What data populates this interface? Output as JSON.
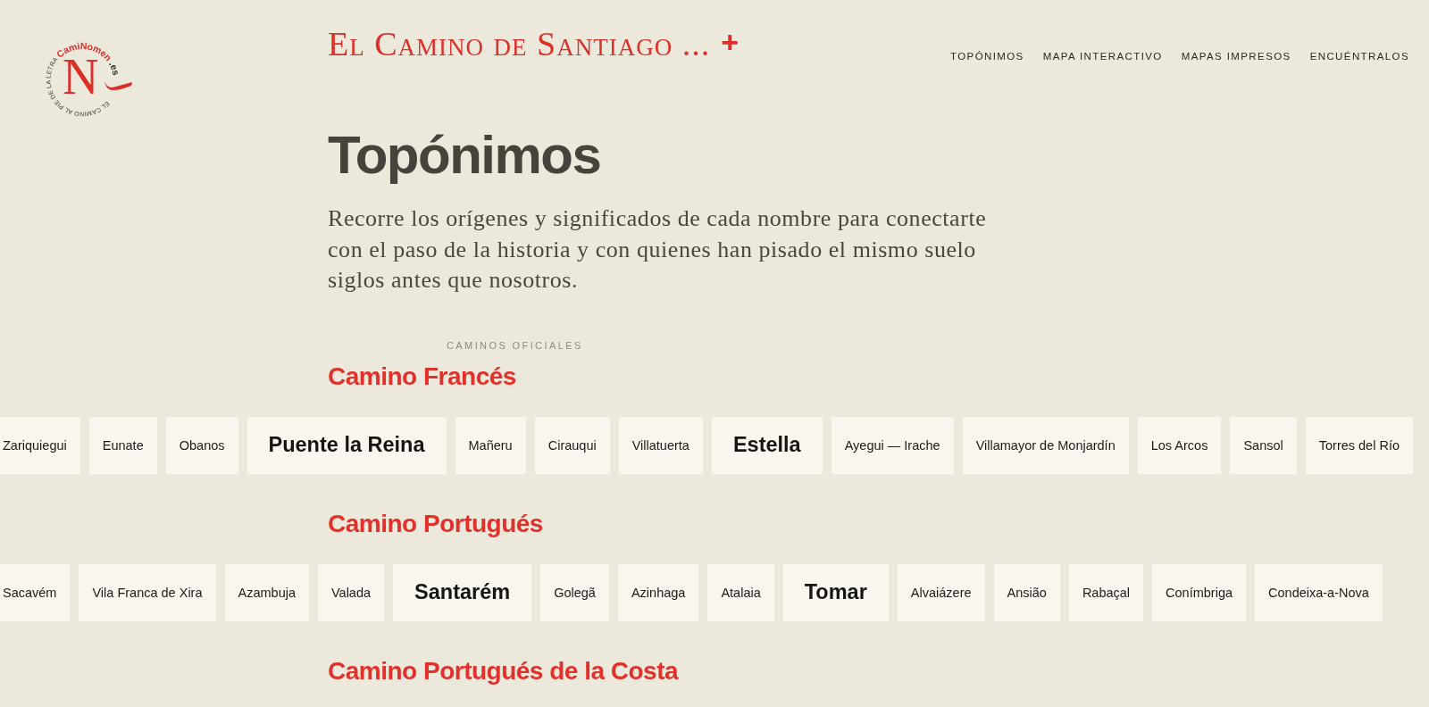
{
  "logo": {
    "wordmark": "CamiNomen",
    "domain": ".es",
    "letter": "N",
    "tagline": "EL CAMINO AL PIE DE LA LETRA"
  },
  "header": {
    "title": "El Camino de Santiago ...",
    "action": "+"
  },
  "nav": [
    {
      "label": "TOPÓNIMOS"
    },
    {
      "label": "MAPA INTERACTIVO"
    },
    {
      "label": "MAPAS IMPRESOS"
    },
    {
      "label": "ENCUÉNTRALOS"
    }
  ],
  "page": {
    "title": "Topónimos",
    "intro": "Recorre los orígenes y significados de cada nombre para conectarte con el paso de la historia y con quienes han pisado el mismo suelo siglos antes que nosotros."
  },
  "section_label": "CAMINOS OFICIALES",
  "routes": [
    {
      "name": "Camino Francés",
      "places": [
        {
          "name": "Zariquiegui",
          "kind": "minor"
        },
        {
          "name": "Eunate",
          "kind": "minor"
        },
        {
          "name": "Obanos",
          "kind": "minor"
        },
        {
          "name": "Puente la Reina",
          "kind": "major"
        },
        {
          "name": "Mañeru",
          "kind": "minor"
        },
        {
          "name": "Cirauqui",
          "kind": "minor"
        },
        {
          "name": "Villatuerta",
          "kind": "minor"
        },
        {
          "name": "Estella",
          "kind": "major"
        },
        {
          "name": "Ayegui — Irache",
          "kind": "minor"
        },
        {
          "name": "Villamayor de Monjardín",
          "kind": "minor"
        },
        {
          "name": "Los Arcos",
          "kind": "minor"
        },
        {
          "name": "Sansol",
          "kind": "minor"
        },
        {
          "name": "Torres del Río",
          "kind": "minor"
        }
      ]
    },
    {
      "name": "Camino Portugués",
      "places": [
        {
          "name": "Sacavém",
          "kind": "minor"
        },
        {
          "name": "Vila Franca de Xira",
          "kind": "minor"
        },
        {
          "name": "Azambuja",
          "kind": "minor"
        },
        {
          "name": "Valada",
          "kind": "minor"
        },
        {
          "name": "Santarém",
          "kind": "major"
        },
        {
          "name": "Golegã",
          "kind": "minor"
        },
        {
          "name": "Azinhaga",
          "kind": "minor"
        },
        {
          "name": "Atalaia",
          "kind": "minor"
        },
        {
          "name": "Tomar",
          "kind": "major"
        },
        {
          "name": "Alvaiázere",
          "kind": "minor"
        },
        {
          "name": "Ansião",
          "kind": "minor"
        },
        {
          "name": "Rabaçal",
          "kind": "minor"
        },
        {
          "name": "Conímbriga",
          "kind": "minor"
        },
        {
          "name": "Condeixa-a-Nova",
          "kind": "minor"
        }
      ]
    },
    {
      "name": "Camino Portugués de la Costa"
    }
  ]
}
